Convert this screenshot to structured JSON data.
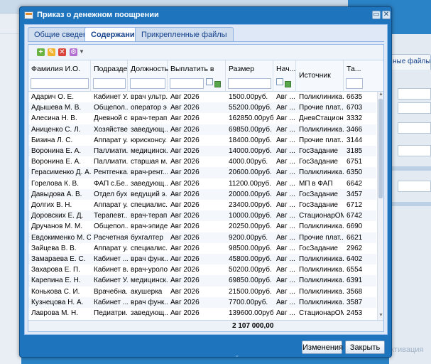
{
  "background": {
    "right_tab": "ные файлы",
    "watermark": "ктивация"
  },
  "window": {
    "title": "Приказ о денежном поощрении",
    "minimize": "▭",
    "close": "✕"
  },
  "tabs": [
    {
      "label": "Общие сведения"
    },
    {
      "label": "Содержание"
    },
    {
      "label": "Прикрепленные файлы"
    }
  ],
  "columns": [
    {
      "label": "Фамилия И.О."
    },
    {
      "label": "Подразде..."
    },
    {
      "label": "Должность"
    },
    {
      "label": "Выплатить в"
    },
    {
      "label": "Размер"
    },
    {
      "label": "Нач..."
    },
    {
      "label": "Источник"
    },
    {
      "label": "Та..."
    }
  ],
  "rows": [
    [
      "Адарич О. Е.",
      "Кабинет У...",
      "врач ультр...",
      "Авг 2026",
      "1500.00руб.",
      "Авг ...",
      "Поликлиника...",
      "6635"
    ],
    [
      "Адышева М. В.",
      "Общепол...",
      "оператор э...",
      "Авг 2026",
      "55200.00руб.",
      "Авг ...",
      "Прочие плат...",
      "6703"
    ],
    [
      "Алесина Н. В.",
      "Дневной с...",
      "врач-терап...",
      "Авг 2026",
      "162850.00руб.",
      "Авг ...",
      "ДневСтацион...",
      "3332"
    ],
    [
      "Аниценко С. Л.",
      "Хозяйстве...",
      "заведующ...",
      "Авг 2026",
      "69850.00руб.",
      "Авг ...",
      "Поликлиника...",
      "3466"
    ],
    [
      "Бизина Л. С.",
      "Аппарат у...",
      "юрисконсу...",
      "Авг 2026",
      "18400.00руб.",
      "Авг ...",
      "Прочие плат...",
      "3144"
    ],
    [
      "Воронина Е. А.",
      "Паллиати...",
      "медицинск...",
      "Авг 2026",
      "14000.00руб.",
      "Авг ...",
      "ГосЗадание",
      "3185"
    ],
    [
      "Воронина Е. А.",
      "Паллиати...",
      "старшая м...",
      "Авг 2026",
      "4000.00руб.",
      "Авг ...",
      "ГосЗадание",
      "6751"
    ],
    [
      "Герасименко Д. А.",
      "Рентгенка...",
      "врач-рент...",
      "Авг 2026",
      "20600.00руб.",
      "Авг ...",
      "Поликлиника...",
      "6350"
    ],
    [
      "Горелова К. В.",
      "ФАП с.Бе...",
      "заведующ...",
      "Авг 2026",
      "11200.00руб.",
      "Авг ...",
      "МП в ФАП",
      "6642"
    ],
    [
      "Давыдова А. В.",
      "Отдел бух...",
      "ведущий э...",
      "Авг 2026",
      "20000.00руб.",
      "Авг ...",
      "ГосЗадание",
      "3457"
    ],
    [
      "Долгих В. Н.",
      "Аппарат у...",
      "специалис...",
      "Авг 2026",
      "23400.00руб.",
      "Авг ...",
      "ГосЗадание",
      "6712"
    ],
    [
      "Доровских Е. Д.",
      "Терапевт...",
      "врач-терап...",
      "Авг 2026",
      "10000.00руб.",
      "Авг ...",
      "СтационарОМС",
      "6742"
    ],
    [
      "Дручанов М. М.",
      "Общепол...",
      "врач-эпиде...",
      "Авг 2026",
      "20250.00руб.",
      "Авг ...",
      "Поликлиника...",
      "6690"
    ],
    [
      "Евдокименко М. С.",
      "Расчетная...",
      "бухгалтер",
      "Авг 2026",
      "9200.00руб.",
      "Авг ...",
      "Прочие плат...",
      "6621"
    ],
    [
      "Зайцева В. В.",
      "Аппарат у...",
      "специалис...",
      "Авг 2026",
      "98500.00руб.",
      "Авг ...",
      "ГосЗадание",
      "2962"
    ],
    [
      "Замараева Е. С.",
      "Кабинет ...",
      "врач функ...",
      "Авг 2026",
      "45800.00руб.",
      "Авг ...",
      "Поликлиника...",
      "6402"
    ],
    [
      "Захарова Е. П.",
      "Кабинет в...",
      "врач-уролог",
      "Авг 2026",
      "50200.00руб.",
      "Авг ...",
      "Поликлиника...",
      "6554"
    ],
    [
      "Карепина Е. Н.",
      "Кабинет У...",
      "медицинск...",
      "Авг 2026",
      "69850.00руб.",
      "Авг ...",
      "Поликлиника...",
      "6391"
    ],
    [
      "Конькова С. И.",
      "Врачебна...",
      "акушерка",
      "Авг 2026",
      "21500.00руб.",
      "Авг ...",
      "Поликлиника...",
      "3568"
    ],
    [
      "Кузнецова Н. А.",
      "Кабинет ...",
      "врач функ...",
      "Авг 2026",
      "7700.00руб.",
      "Авг ...",
      "Поликлиника...",
      "3587"
    ],
    [
      "Лаврова М. Н.",
      "Педиатри...",
      "заведующ...",
      "Авг 2026",
      "139600.00руб.",
      "Авг ...",
      "СтационарОМС",
      "2453"
    ]
  ],
  "total": "2 107 000,00",
  "buttons": {
    "changes": "Изменения",
    "close": "Закрыть"
  }
}
